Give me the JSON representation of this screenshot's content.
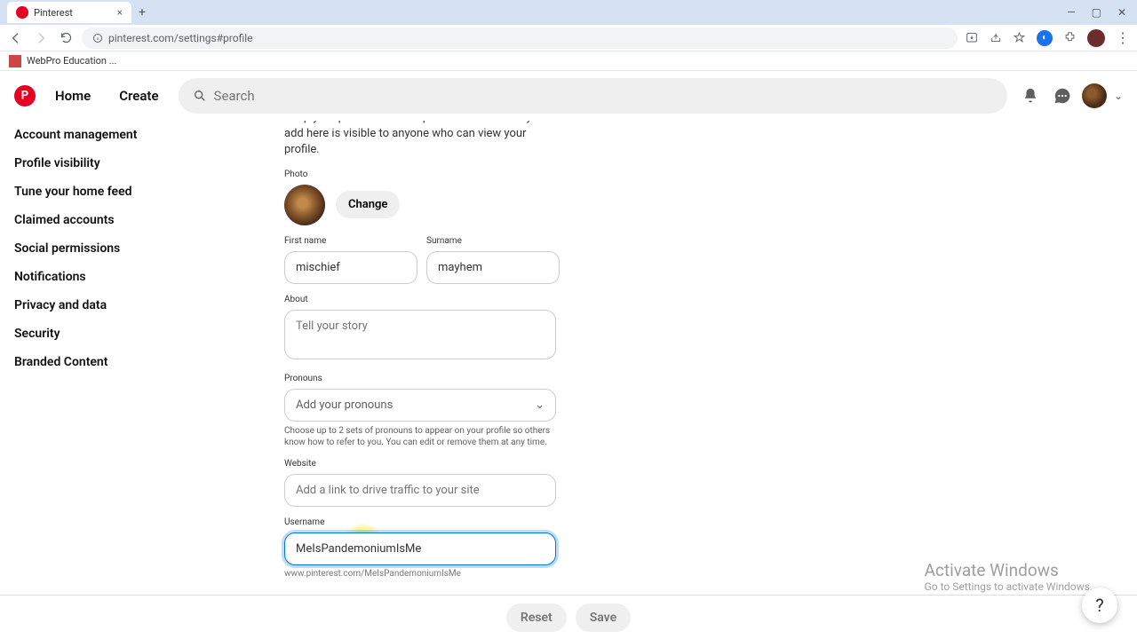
{
  "browser": {
    "tab_title": "Pinterest",
    "url": "pinterest.com/settings#profile",
    "bookmark": "WebPro Education ..."
  },
  "header": {
    "home": "Home",
    "create": "Create",
    "search_placeholder": "Search"
  },
  "sidebar": {
    "items": [
      "Account management",
      "Profile visibility",
      "Tune your home feed",
      "Claimed accounts",
      "Social permissions",
      "Notifications",
      "Privacy and data",
      "Security",
      "Branded Content"
    ]
  },
  "form": {
    "intro_line1": "Keep your personal details private. Information you add here is",
    "intro_line2": "visible to anyone who can view your profile.",
    "photo_label": "Photo",
    "change_btn": "Change",
    "first_name_label": "First name",
    "first_name_value": "mischief",
    "surname_label": "Surname",
    "surname_value": "mayhem",
    "about_label": "About",
    "about_placeholder": "Tell your story",
    "pronouns_label": "Pronouns",
    "pronouns_placeholder": "Add your pronouns",
    "pronouns_help": "Choose up to 2 sets of pronouns to appear on your profile so others know how to refer to you. You can edit or remove them at any time.",
    "website_label": "Website",
    "website_placeholder": "Add a link to drive traffic to your site",
    "username_label": "Username",
    "username_value": "MeIsPandemoniumIsMe",
    "username_url": "www.pinterest.com/MeIsPandemoniumIsMe"
  },
  "footer": {
    "reset": "Reset",
    "save": "Save"
  },
  "watermark": {
    "title": "Activate Windows",
    "subtitle": "Go to Settings to activate Windows."
  },
  "help_fab": "?"
}
